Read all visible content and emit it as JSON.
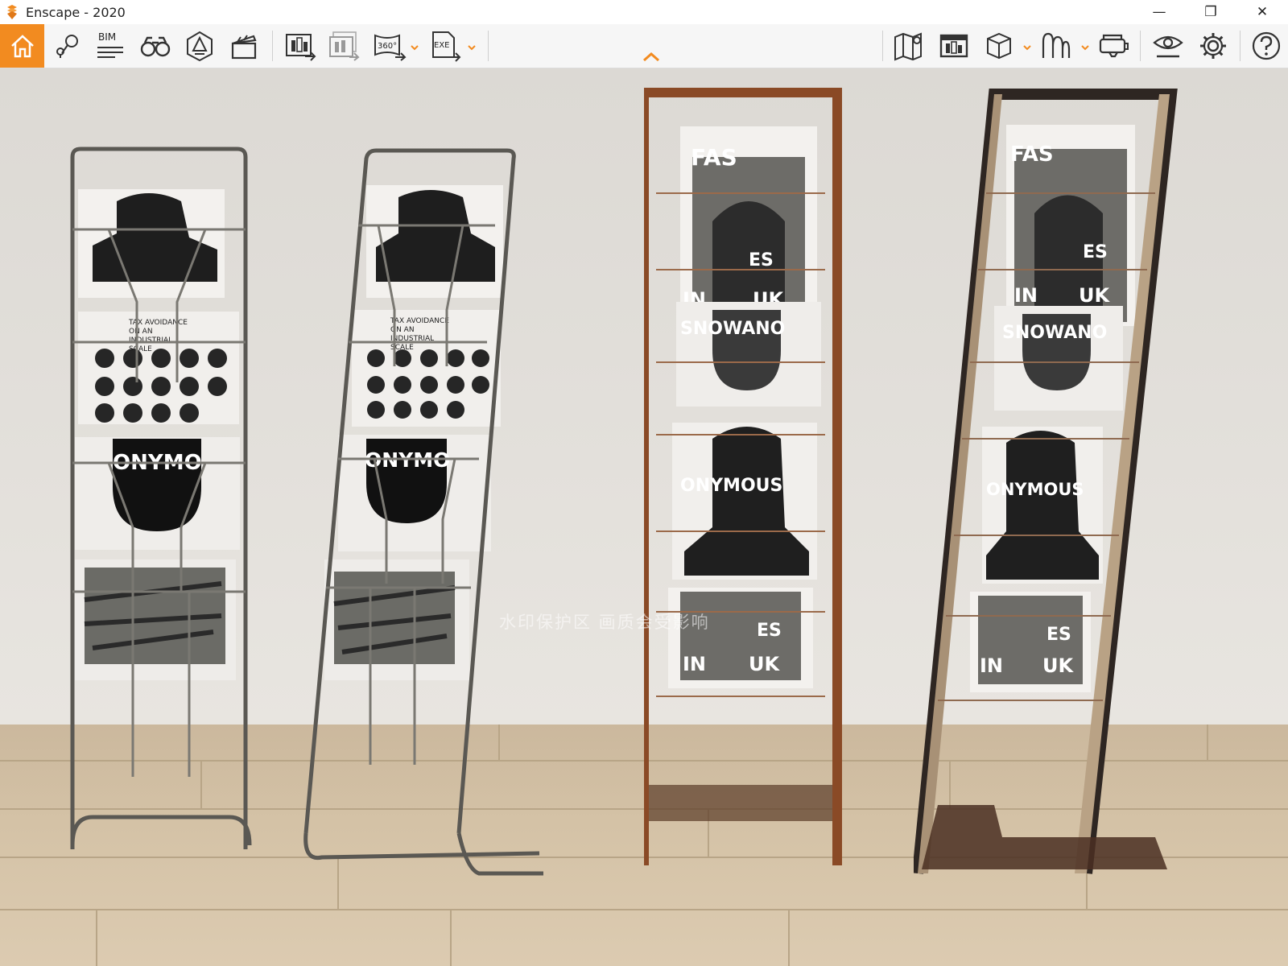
{
  "window": {
    "title": "Enscape - 2020",
    "controls": {
      "minimize": "—",
      "restore": "❐",
      "close": "✕"
    }
  },
  "toolbar": {
    "bim_label": "BIM",
    "panorama_label": "360°",
    "exe_label": "EXE",
    "accent_color": "#f28b20",
    "icons": [
      "home-icon",
      "location-pins-icon",
      "bim-info-icon",
      "binoculars-icon",
      "atmosphere-icon",
      "video-editor-icon",
      "render-screenshot-icon",
      "batch-render-icon",
      "panorama-360-icon",
      "export-exe-icon",
      "minimap-icon",
      "asset-library-icon",
      "view-mode-cube-icon",
      "material-editor-icon",
      "vr-headset-icon",
      "visual-settings-icon",
      "general-settings-icon",
      "help-icon"
    ]
  },
  "scene": {
    "watermark": "水印保护区  画质会受影响",
    "magazines": {
      "tax_title": [
        "TAX AVOIDANCE",
        "ON AN",
        "INDUSTRIAL",
        "SCALE"
      ],
      "anonymous_mirrored": "ONYMO",
      "anonymous": "ONYMOUS",
      "anonymous_upside": "SNOWANO",
      "fast": "FAS",
      "in": "IN",
      "uk": "UK",
      "es": "ES"
    }
  }
}
